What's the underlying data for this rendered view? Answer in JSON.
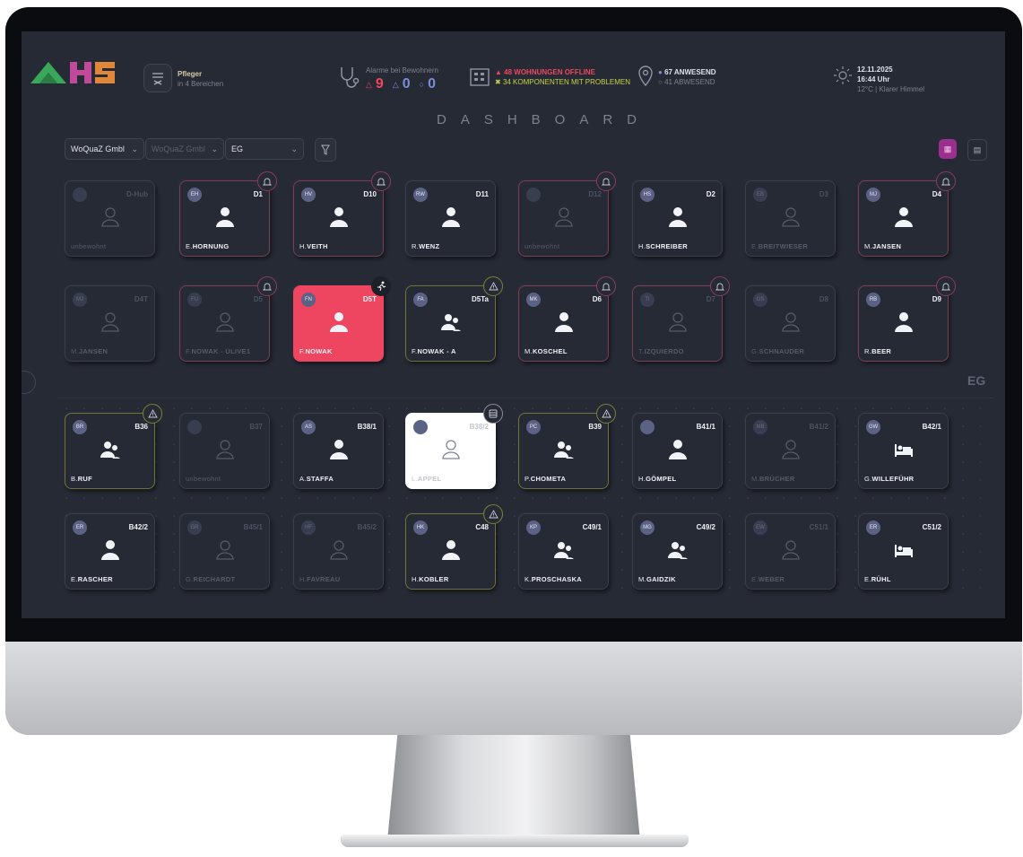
{
  "header": {
    "role": "Pfleger",
    "role_sub": "in 4 Bereichen",
    "alarms_title": "Alarme bei Bewohnern",
    "alarm_red_count": "9",
    "alarm_warn_count": "0",
    "alarm_info_count": "0",
    "offline_text": "48 WOHNUNGEN OFFLINE",
    "problems_text": "34 KOMPONENTEN MIT PROBLEMEN",
    "present_text": "67 ANWESEND",
    "absent_text": "41 ABWESEND",
    "date": "12.11.2025",
    "time": "16:44 Uhr",
    "weather": "12°C | Klarer Himmel",
    "title": "DASHBOARD"
  },
  "filters": {
    "company": "WoQuaZ Gmbl",
    "company2": "WoQuaZ Gmbl",
    "floor": "EG"
  },
  "floor_label": "EG",
  "colors": {
    "accent": "#9b2f8f",
    "alarm_red": "#ee4660",
    "warn_olive": "#c8d24a",
    "offline_red": "#ee4660"
  },
  "tiles_top": [
    {
      "initials": "",
      "code": "D-Hub",
      "first": "unbewohnt",
      "last": "",
      "state": "dim",
      "glyph": "outline",
      "badge": ""
    },
    {
      "initials": "EH",
      "code": "D1",
      "first": "E.",
      "last": "HORNUNG",
      "state": "pink",
      "glyph": "person",
      "badge": "bell"
    },
    {
      "initials": "HV",
      "code": "D10",
      "first": "H.",
      "last": "VEITH",
      "state": "pink",
      "glyph": "person",
      "badge": "bell"
    },
    {
      "initials": "RW",
      "code": "D11",
      "first": "R.",
      "last": "WENZ",
      "state": "",
      "glyph": "person",
      "badge": ""
    },
    {
      "initials": "",
      "code": "D12",
      "first": "unbewohnt",
      "last": "",
      "state": "dim-pink",
      "glyph": "outline",
      "badge": "bell"
    },
    {
      "initials": "HS",
      "code": "D2",
      "first": "H.",
      "last": "SCHREIBER",
      "state": "",
      "glyph": "person",
      "badge": ""
    },
    {
      "initials": "EB",
      "code": "D3",
      "first": "E.",
      "last": "BREITWIESER",
      "state": "dim",
      "glyph": "outline",
      "badge": ""
    },
    {
      "initials": "MJ",
      "code": "D4",
      "first": "M.",
      "last": "JANSEN",
      "state": "pink",
      "glyph": "person",
      "badge": "bell"
    },
    {
      "initials": "MJ",
      "code": "D4T",
      "first": "M.",
      "last": "JANSEN",
      "state": "dim",
      "glyph": "outline",
      "badge": ""
    },
    {
      "initials": "FU",
      "code": "D5",
      "first": "F.",
      "last": "NOWAK - ULIVE1",
      "state": "dim-pink",
      "glyph": "outline",
      "badge": "bell"
    },
    {
      "initials": "FN",
      "code": "D5T",
      "first": "F.",
      "last": "NOWAK",
      "state": "red",
      "glyph": "person",
      "badge": "fall"
    },
    {
      "initials": "FA",
      "code": "D5Ta",
      "first": "F.",
      "last": "NOWAK - A",
      "state": "olive",
      "glyph": "group",
      "badge": "warn"
    },
    {
      "initials": "MK",
      "code": "D6",
      "first": "M.",
      "last": "KOSCHEL",
      "state": "pink",
      "glyph": "person",
      "badge": "bell"
    },
    {
      "initials": "TI",
      "code": "D7",
      "first": "T.",
      "last": "IZQUIERDO",
      "state": "dim-pink",
      "glyph": "outline",
      "badge": "bell"
    },
    {
      "initials": "GS",
      "code": "D8",
      "first": "G.",
      "last": "SCHNAUDER",
      "state": "dim",
      "glyph": "outline",
      "badge": ""
    },
    {
      "initials": "RB",
      "code": "D9",
      "first": "R.",
      "last": "BEER",
      "state": "pink",
      "glyph": "person",
      "badge": "bell"
    }
  ],
  "tiles_bottom": [
    {
      "initials": "BR",
      "code": "B36",
      "first": "B.",
      "last": "RUF",
      "state": "olive",
      "glyph": "group",
      "badge": "warn"
    },
    {
      "initials": "",
      "code": "B37",
      "first": "unbewohnt",
      "last": "",
      "state": "dim",
      "glyph": "outline",
      "badge": ""
    },
    {
      "initials": "AS",
      "code": "B38/1",
      "first": "A.",
      "last": "STAFFA",
      "state": "",
      "glyph": "person",
      "badge": ""
    },
    {
      "initials": "",
      "code": "B38/2",
      "first": "L.",
      "last": "APPEL",
      "state": "white",
      "glyph": "outline",
      "badge": "db"
    },
    {
      "initials": "PC",
      "code": "B39",
      "first": "P.",
      "last": "CHOMETA",
      "state": "olive",
      "glyph": "group",
      "badge": "warn"
    },
    {
      "initials": "",
      "code": "B41/1",
      "first": "H.",
      "last": "GÖMPEL",
      "state": "",
      "glyph": "person",
      "badge": ""
    },
    {
      "initials": "MB",
      "code": "B41/2",
      "first": "M.",
      "last": "BRÜCHER",
      "state": "dim",
      "glyph": "outline",
      "badge": ""
    },
    {
      "initials": "GW",
      "code": "B42/1",
      "first": "G.",
      "last": "WILLEFÜHR",
      "state": "",
      "glyph": "bed",
      "badge": ""
    },
    {
      "initials": "ER",
      "code": "B42/2",
      "first": "E.",
      "last": "RASCHER",
      "state": "",
      "glyph": "person",
      "badge": ""
    },
    {
      "initials": "GR",
      "code": "B45/1",
      "first": "G.",
      "last": "REICHARDT",
      "state": "dim",
      "glyph": "outline",
      "badge": ""
    },
    {
      "initials": "HF",
      "code": "B45/2",
      "first": "H.",
      "last": "FAVREAU",
      "state": "dim",
      "glyph": "outline",
      "badge": ""
    },
    {
      "initials": "HK",
      "code": "C48",
      "first": "H.",
      "last": "KOBLER",
      "state": "olive",
      "glyph": "person",
      "badge": "warn"
    },
    {
      "initials": "KP",
      "code": "C49/1",
      "first": "K.",
      "last": "PROSCHASKA",
      "state": "",
      "glyph": "group",
      "badge": ""
    },
    {
      "initials": "MG",
      "code": "C49/2",
      "first": "M.",
      "last": "GAIDZIK",
      "state": "",
      "glyph": "group",
      "badge": ""
    },
    {
      "initials": "EW",
      "code": "C51/1",
      "first": "E.",
      "last": "WEBER",
      "state": "dim",
      "glyph": "outline",
      "badge": ""
    },
    {
      "initials": "ER",
      "code": "C51/2",
      "first": "E.",
      "last": "RÜHL",
      "state": "",
      "glyph": "bed",
      "badge": ""
    }
  ]
}
